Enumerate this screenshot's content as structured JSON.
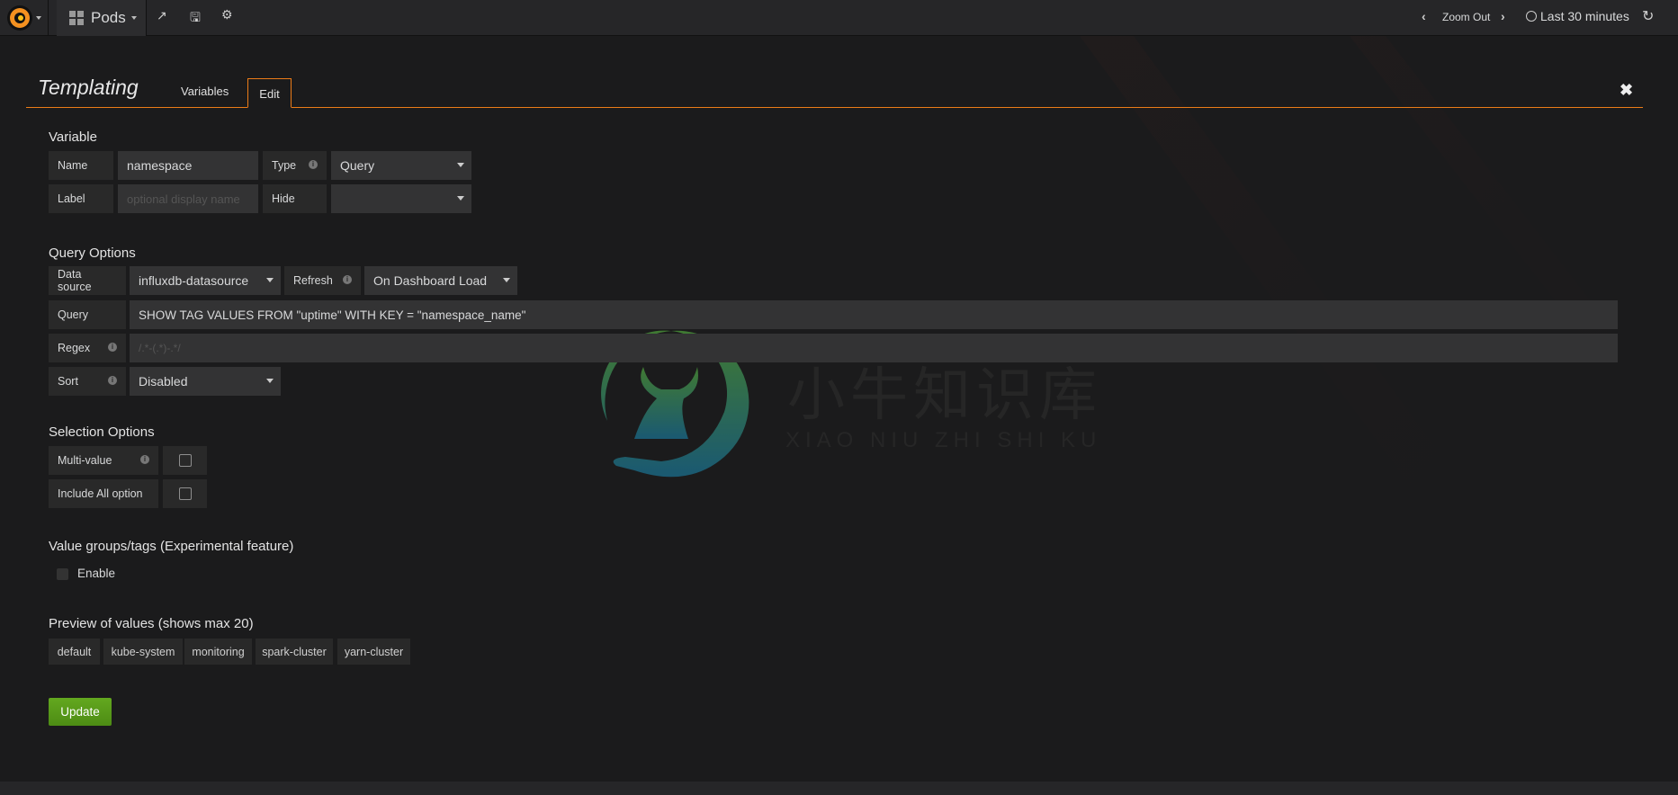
{
  "navbar": {
    "dashboard_title": "Pods",
    "zoom_out": "Zoom Out",
    "time_range": "Last 30 minutes",
    "icons": [
      "grafana-logo",
      "dashboard-grid-icon",
      "share-icon",
      "save-icon",
      "gear-icon",
      "chevron-left-icon",
      "chevron-right-icon",
      "clock-icon",
      "refresh-icon"
    ]
  },
  "templating": {
    "title": "Templating",
    "tabs": [
      {
        "label": "Variables",
        "active": false
      },
      {
        "label": "Edit",
        "active": true
      }
    ],
    "accent_color": "#eb7b18"
  },
  "variable": {
    "heading": "Variable",
    "name_label": "Name",
    "name_value": "namespace",
    "type_label": "Type",
    "type_value": "Query",
    "label_label": "Label",
    "label_placeholder": "optional display name",
    "hide_label": "Hide",
    "hide_value": ""
  },
  "query_options": {
    "heading": "Query Options",
    "datasource_label": "Data source",
    "datasource_value": "influxdb-datasource",
    "refresh_label": "Refresh",
    "refresh_value": "On Dashboard Load",
    "query_label": "Query",
    "query_value": "SHOW TAG VALUES FROM \"uptime\" WITH KEY = \"namespace_name\"",
    "regex_label": "Regex",
    "regex_placeholder": "/.*-(.*)-.*/",
    "sort_label": "Sort",
    "sort_value": "Disabled"
  },
  "selection_options": {
    "heading": "Selection Options",
    "multi_value_label": "Multi-value",
    "multi_value_checked": false,
    "include_all_label": "Include All option",
    "include_all_checked": false
  },
  "value_groups": {
    "heading": "Value groups/tags (Experimental feature)",
    "enable_label": "Enable",
    "enable_checked": false
  },
  "preview": {
    "heading": "Preview of values (shows max 20)",
    "values": [
      "default",
      "kube-system",
      "monitoring",
      "spark-cluster",
      "yarn-cluster"
    ]
  },
  "update_button": "Update",
  "update_color": "#5a9e1a",
  "watermark": {
    "title": "小牛知识库",
    "subtitle": "XIAO NIU ZHI SHI KU"
  }
}
